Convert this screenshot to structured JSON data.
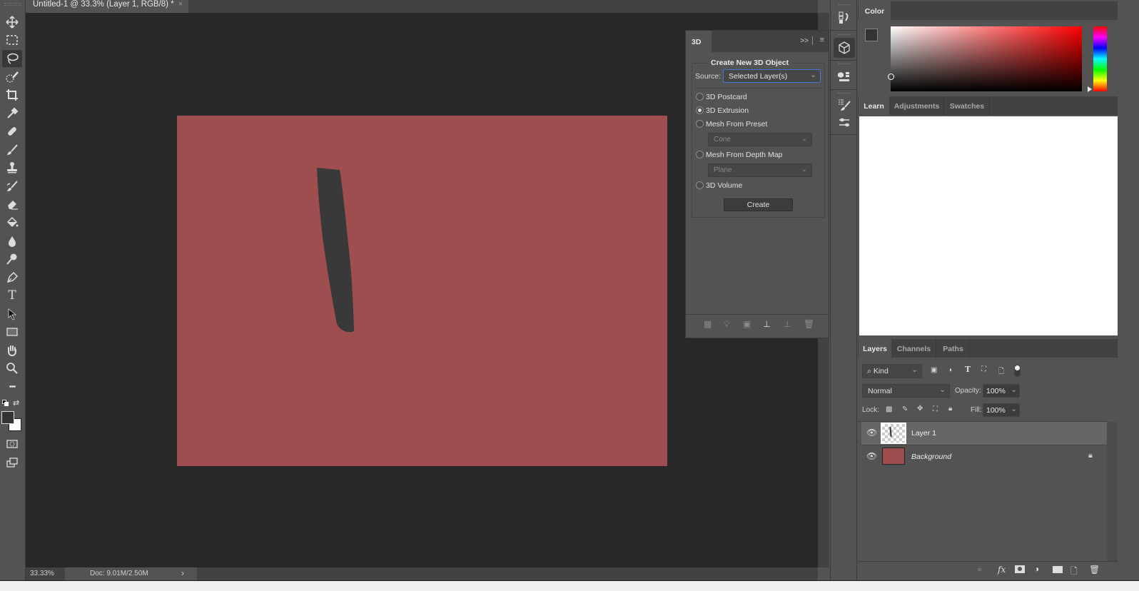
{
  "document": {
    "tab_title": "Untitled-1 @ 33.3% (Layer 1, RGB/8) *",
    "close_glyph": "×",
    "canvas_color": "#9f4e4f",
    "stroke_color": "#3a3a3a"
  },
  "toolbar": {
    "tools": [
      {
        "name": "move-tool",
        "icon": "move-icon"
      },
      {
        "name": "rectangular-marquee-tool",
        "icon": "marquee-icon"
      },
      {
        "name": "lasso-tool",
        "icon": "lasso-icon",
        "active": true
      },
      {
        "name": "quick-selection-tool",
        "icon": "quick-selection-icon"
      },
      {
        "name": "crop-tool",
        "icon": "crop-icon"
      },
      {
        "name": "eyedropper-tool",
        "icon": "eyedropper-icon"
      },
      {
        "name": "healing-brush-tool",
        "icon": "bandage-icon"
      },
      {
        "name": "brush-tool",
        "icon": "brush-icon"
      },
      {
        "name": "clone-stamp-tool",
        "icon": "stamp-icon"
      },
      {
        "name": "history-brush-tool",
        "icon": "history-brush-icon"
      },
      {
        "name": "eraser-tool",
        "icon": "eraser-icon"
      },
      {
        "name": "paint-bucket-tool",
        "icon": "bucket-icon"
      },
      {
        "name": "blur-tool",
        "icon": "drop-icon"
      },
      {
        "name": "dodge-tool",
        "icon": "dodge-icon"
      },
      {
        "name": "pen-tool",
        "icon": "pen-icon"
      },
      {
        "name": "type-tool",
        "icon": "type-icon",
        "glyph": "T"
      },
      {
        "name": "path-selection-tool",
        "icon": "arrow-icon"
      },
      {
        "name": "rectangle-tool",
        "icon": "rectangle-icon"
      },
      {
        "name": "hand-tool",
        "icon": "hand-icon"
      },
      {
        "name": "zoom-tool",
        "icon": "magnifier-icon"
      },
      {
        "name": "edit-toolbar",
        "icon": "ellipsis-icon",
        "glyph": "•••"
      }
    ],
    "foreground_color": "#333333",
    "background_color": "#ffffff"
  },
  "status_bar": {
    "zoom": "33.33%",
    "doc_info": "Doc: 9.01M/2.50M",
    "arrow": "›"
  },
  "panel_3d": {
    "tab": "3D",
    "collapse_glyph": ">>",
    "group_title": "Create New 3D Object",
    "source_label": "Source:",
    "source_value": "Selected Layer(s)",
    "options": [
      {
        "label": "3D Postcard",
        "selected": false
      },
      {
        "label": "3D Extrusion",
        "selected": true
      },
      {
        "label": "Mesh From Preset",
        "selected": false
      },
      {
        "label": "Mesh From Depth Map",
        "selected": false
      },
      {
        "label": "3D Volume",
        "selected": false
      }
    ],
    "preset_value": "Cone",
    "depth_map_value": "Plane",
    "create_label": "Create"
  },
  "color_panel": {
    "tab": "Color",
    "hue_color": "#ff0000"
  },
  "learn_panel": {
    "tabs": [
      "Learn",
      "Adjustments",
      "Swatches"
    ]
  },
  "layers_panel": {
    "tabs": [
      "Layers",
      "Channels",
      "Paths"
    ],
    "filter_label": "Kind",
    "blend_mode": "Normal",
    "opacity_label": "Opacity:",
    "opacity_value": "100%",
    "lock_label": "Lock:",
    "fill_label": "Fill:",
    "fill_value": "100%",
    "layers": [
      {
        "name": "Layer 1",
        "selected": true,
        "visible": true,
        "locked": false
      },
      {
        "name": "Background",
        "selected": false,
        "visible": true,
        "locked": true
      }
    ]
  }
}
